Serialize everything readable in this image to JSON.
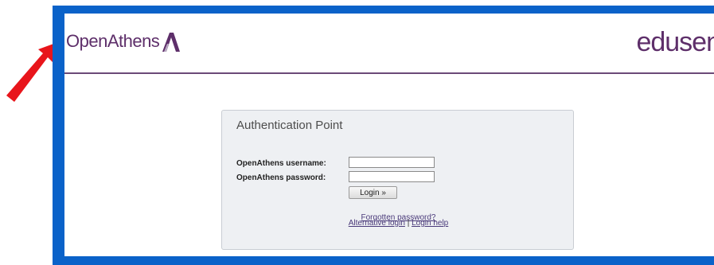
{
  "header": {
    "left_logo_text": "OpenAthens",
    "right_logo_text": "edusen"
  },
  "auth": {
    "title": "Authentication Point",
    "username_label": "OpenAthens username:",
    "username_value": "",
    "password_label": "OpenAthens password:",
    "password_value": "",
    "login_button": "Login »",
    "forgot_link": "Forgotten password?",
    "alt_login_link": "Alternative login",
    "separator": "|",
    "help_link": "Login help"
  },
  "colors": {
    "frame_blue": "#0a62c9",
    "brand_purple": "#5e2f6a",
    "arrow_red": "#e8151b"
  },
  "icons": {
    "athens_logo": "athens-a-logo-icon",
    "pointer": "red-arrow-icon"
  }
}
